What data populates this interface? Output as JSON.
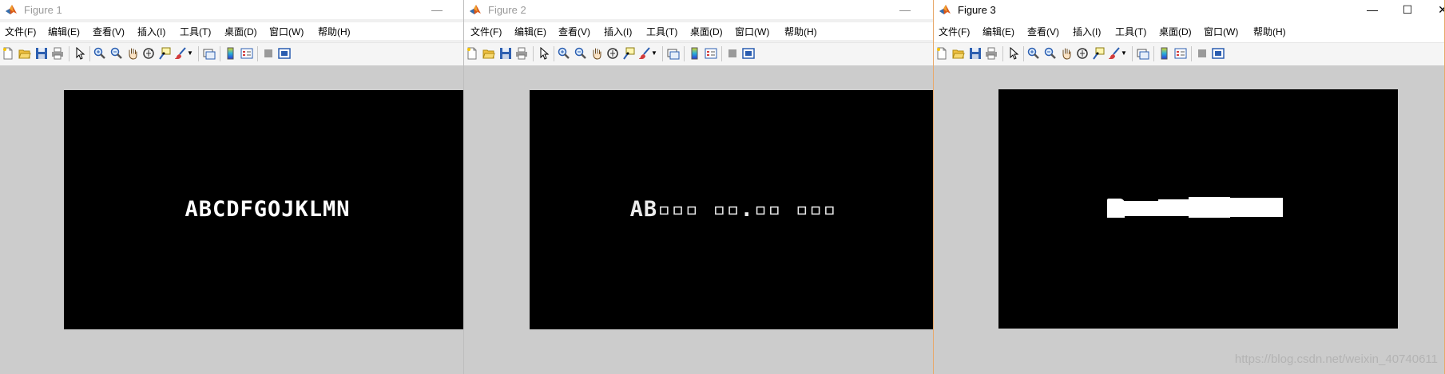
{
  "figure1": {
    "title": "Figure 1",
    "image_text": "ABCDFGOJKLMN"
  },
  "figure2": {
    "title": "Figure 2",
    "image_text": "AB▫▫▫ ▫▫.▫▫ ▫▫▫"
  },
  "figure3": {
    "title": "Figure 3",
    "watermark": "https://blog.csdn.net/weixin_40740611"
  },
  "menu": {
    "file": "文件(F)",
    "edit": "编辑(E)",
    "view": "查看(V)",
    "insert": "插入(I)",
    "tools": "工具(T)",
    "desktop": "桌面(D)",
    "window": "窗口(W)",
    "help": "帮助(H)"
  },
  "window_controls": {
    "minimize": "—",
    "maximize": "☐",
    "close": "✕"
  },
  "toolbar_icons": [
    "new-figure-icon",
    "open-file-icon",
    "save-icon",
    "print-icon",
    "edit-plot-arrow-icon",
    "zoom-in-icon",
    "zoom-out-icon",
    "pan-hand-icon",
    "rotate-3d-icon",
    "data-cursor-icon",
    "brush-icon",
    "link-plot-icon",
    "colorbar-icon",
    "legend-icon",
    "hide-plot-tools-icon",
    "show-plot-tools-icon"
  ],
  "colors": {
    "figure_background": "#cccccc",
    "axes_background": "#000000",
    "text": "#ffffff",
    "active_border": "#e8a86a"
  }
}
